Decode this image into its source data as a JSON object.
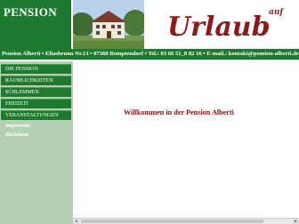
{
  "header": {
    "brand_title": "PENSION",
    "urlaub_word": "Urlaub",
    "urlaub_small": "auf"
  },
  "address_bar": {
    "text": "Pension Alberti • Eliasbrunn Nr.13 • 07368 Remptendorf • Tel.: 03 66 51_8 82 16 • E-mail.: kontakt@pension-alberti.de"
  },
  "nav": {
    "items": [
      {
        "label": "DIE PENSION"
      },
      {
        "label": "RÄUMLICHKEITEN"
      },
      {
        "label": "SCHLEMMEN"
      },
      {
        "label": "FREIZEIT"
      },
      {
        "label": "VERANSTALTUNGEN"
      }
    ],
    "links": [
      {
        "label": "impressum"
      },
      {
        "label": "disclaimer"
      }
    ]
  },
  "main": {
    "welcome": "Willkommen in der Pension Alberti"
  },
  "icons": {
    "scroll_left": "arrow-left-icon",
    "scroll_right": "arrow-right-icon"
  },
  "colors": {
    "brand_green": "#1e7a2e",
    "nav_bg": "#b4cfb4",
    "welcome_red": "#8b0f0f",
    "urlaub_red": "#8b1a1a"
  }
}
